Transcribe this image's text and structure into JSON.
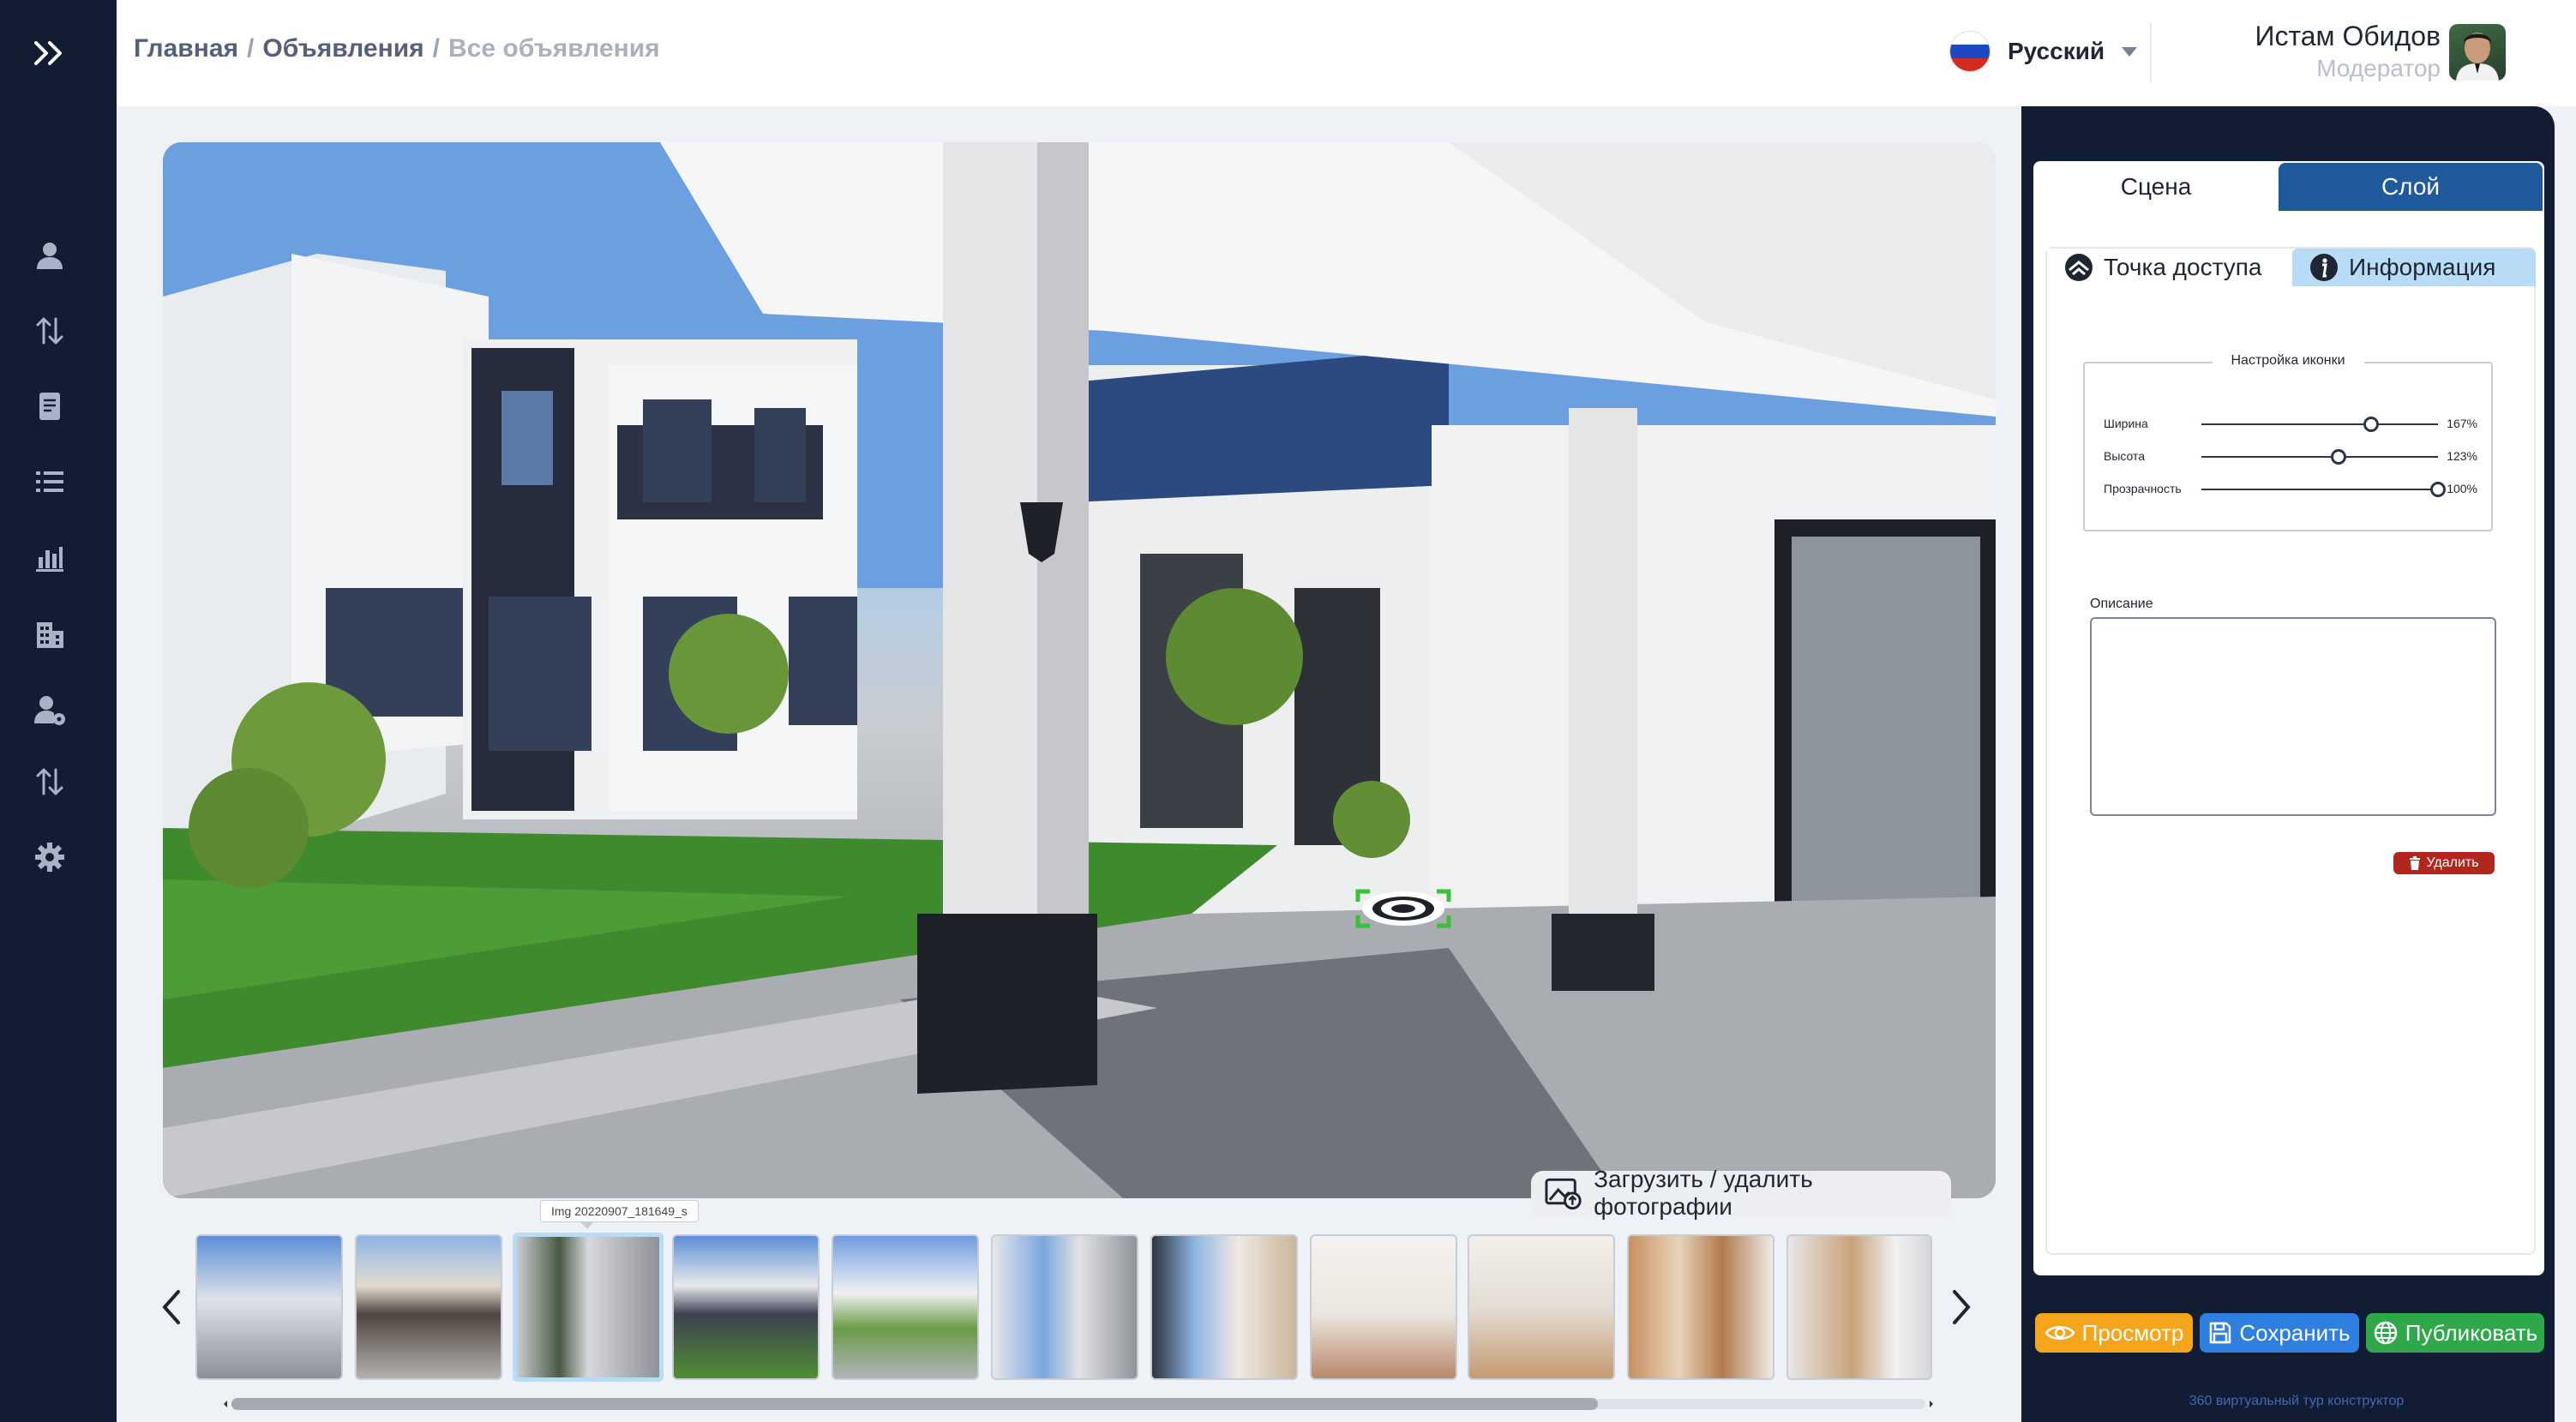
{
  "breadcrumb": {
    "home": "Главная",
    "section": "Объявления",
    "current": "Все объявления",
    "separator": "/"
  },
  "header": {
    "language": "Русский",
    "user_name": "Истам Обидов",
    "user_role": "Модератор"
  },
  "sidebar": {
    "icons": [
      "user-icon",
      "transfer-arrows-icon",
      "document-icon",
      "list-icon",
      "bar-chart-icon",
      "building-icon",
      "user-settings-icon",
      "transfer-arrows-icon",
      "gear-icon"
    ]
  },
  "viewer": {
    "upload_label": "Загрузить / удалить фотографии",
    "thumbnail_tooltip": "Img 20220907_181649_s",
    "active_thumbnail_index": 2,
    "thumbnail_count": 11
  },
  "panel": {
    "tabs": [
      "Сцена",
      "Слой"
    ],
    "subtabs": [
      "Точка доступа",
      "Информация"
    ],
    "icon_settings_title": "Настройка иконки",
    "sliders": [
      {
        "label": "Ширина",
        "value_text": "167%",
        "level": 0.72
      },
      {
        "label": "Высота",
        "value_text": "123%",
        "level": 0.58
      },
      {
        "label": "Прозрачность",
        "value_text": "100%",
        "level": 1.0
      }
    ],
    "description_label": "Описание",
    "description_value": "",
    "delete_label": "Удалить"
  },
  "actions": {
    "preview": "Просмотр",
    "save": "Сохранить",
    "publish": "Публиковать"
  },
  "footer": "360 виртуальный тур конструктор",
  "colors": {
    "sidebar_bg": "#121c32",
    "layer_tab": "#1e5a9c",
    "info_tab": "#b9dcf6",
    "preview": "#f4a51c",
    "save": "#2f7fe0",
    "publish": "#2ea84a",
    "delete": "#b3261e"
  }
}
